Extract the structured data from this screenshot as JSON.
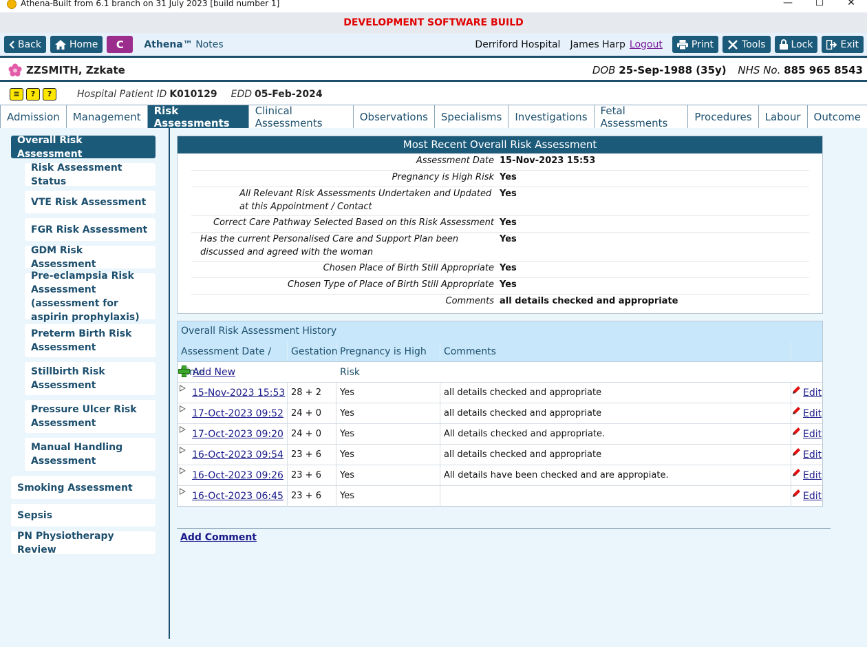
{
  "window": {
    "title": "Athena-Built from 6.1 branch on 31 July 2023 [build number 1]",
    "minimize": "—",
    "maximize": "☐",
    "close": "✕"
  },
  "banner": {
    "text": "DEVELOPMENT SOFTWARE BUILD",
    "color": "#e10000"
  },
  "toolbar": {
    "back_label": "Back",
    "home_label": "Home",
    "c_label": "C",
    "brand_name": "Athena™",
    "brand_suffix": "Notes",
    "hospital": "Derriford Hospital",
    "user": "James Harp",
    "logout_label": "Logout",
    "print_label": "Print",
    "tools_label": "Tools",
    "lock_label": "Lock",
    "exit_label": "Exit"
  },
  "patient": {
    "name": "ZZSMITH, Zzkate",
    "dob_label": "DOB",
    "dob_value": "25-Sep-1988 (35y)",
    "nhs_label": "NHS No.",
    "nhs_value": "885 965 8543",
    "hospital_id_label": "Hospital Patient ID",
    "hospital_id_value": "K010129",
    "edd_label": "EDD",
    "edd_value": "05-Feb-2024"
  },
  "tabs": [
    {
      "label": "Admission"
    },
    {
      "label": "Management"
    },
    {
      "label": "Risk Assessments"
    },
    {
      "label": "Clinical Assessments"
    },
    {
      "label": "Observations"
    },
    {
      "label": "Specialisms"
    },
    {
      "label": "Investigations"
    },
    {
      "label": "Fetal Assessments"
    },
    {
      "label": "Procedures"
    },
    {
      "label": "Labour"
    },
    {
      "label": "Outcome"
    }
  ],
  "sidebar": {
    "items": [
      {
        "label": "Overall Risk Assessment"
      },
      {
        "label": "Risk Assessment Status"
      },
      {
        "label": "VTE Risk Assessment"
      },
      {
        "label": "FGR Risk Assessment"
      },
      {
        "label": "GDM Risk Assessment"
      },
      {
        "label": "Pre-eclampsia Risk Assessment (assessment for aspirin prophylaxis)"
      },
      {
        "label": "Preterm Birth Risk Assessment"
      },
      {
        "label": "Stillbirth Risk Assessment"
      },
      {
        "label": "Pressure Ulcer Risk Assessment"
      },
      {
        "label": "Manual Handling Assessment"
      },
      {
        "label": "Smoking Assessment"
      },
      {
        "label": "Sepsis"
      },
      {
        "label": "PN Physiotherapy Review"
      }
    ]
  },
  "recent": {
    "title": "Most Recent Overall Risk Assessment",
    "rows": [
      {
        "label": "Assessment Date",
        "value": "15-Nov-2023 15:53"
      },
      {
        "label": "Pregnancy is High Risk",
        "value": "Yes"
      },
      {
        "label": "All Relevant Risk Assessments Undertaken and Updated at this Appointment / Contact",
        "value": "Yes"
      },
      {
        "label": "Correct Care Pathway Selected Based on this Risk Assessment",
        "value": "Yes"
      },
      {
        "label": "Has the current Personalised Care and Support Plan been discussed and agreed with the woman",
        "value": "Yes"
      },
      {
        "label": "Chosen Place of Birth Still Appropriate",
        "value": "Yes"
      },
      {
        "label": "Chosen Type of Place of Birth Still Appropriate",
        "value": "Yes"
      },
      {
        "label": "Comments",
        "value": "all details checked and appropriate"
      }
    ]
  },
  "history": {
    "title": "Overall Risk Assessment History",
    "columns": [
      "Assessment Date / Time",
      "Gestation",
      "Pregnancy is High Risk",
      "Comments"
    ],
    "add_new_label": "Add New",
    "edit_label": "Edit",
    "rows": [
      {
        "date": "15-Nov-2023 15:53",
        "gestation": "28 + 2",
        "high_risk": "Yes",
        "comments": "all details checked and appropriate"
      },
      {
        "date": "17-Oct-2023 09:52",
        "gestation": "24 + 0",
        "high_risk": "Yes",
        "comments": "all details checked and appropriate"
      },
      {
        "date": "17-Oct-2023 09:20",
        "gestation": "24 + 0",
        "high_risk": "Yes",
        "comments": "All details checked and appropriate."
      },
      {
        "date": "16-Oct-2023 09:54",
        "gestation": "23 + 6",
        "high_risk": "Yes",
        "comments": "all details checked and appropriate"
      },
      {
        "date": "16-Oct-2023 09:26",
        "gestation": "23 + 6",
        "high_risk": "Yes",
        "comments": "All details have been checked and are appropiate."
      },
      {
        "date": "16-Oct-2023 06:45",
        "gestation": "23 + 6",
        "high_risk": "Yes",
        "comments": ""
      }
    ]
  },
  "add_comment_label": "Add Comment",
  "colors": {
    "primary": "#1c5a7a",
    "accent_c": "#9b2d8c",
    "panel_bg": "#eaf5fc",
    "history_header": "#c9e7fa"
  }
}
